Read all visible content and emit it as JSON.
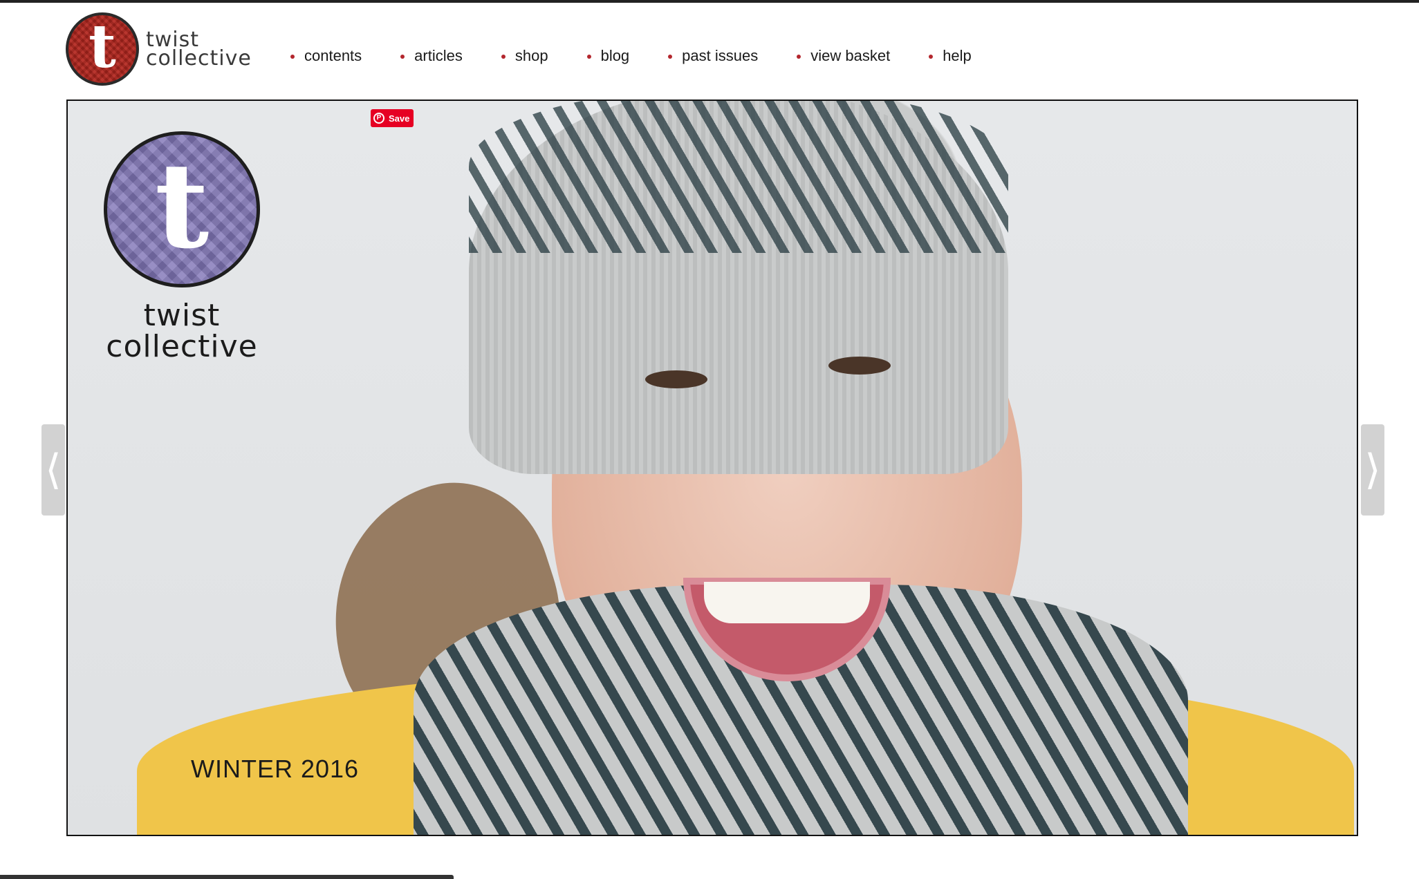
{
  "site": {
    "logo_line1": "twist",
    "logo_line2": "collective",
    "logo_letter": "t",
    "brand_red": "#b3261e"
  },
  "nav": {
    "items": [
      {
        "label": "contents"
      },
      {
        "label": "articles"
      },
      {
        "label": "shop"
      },
      {
        "label": "blog"
      },
      {
        "label": "past issues"
      },
      {
        "label": "view basket"
      },
      {
        "label": "help"
      }
    ],
    "bullet_color": "#b3262d"
  },
  "hero": {
    "pin_button": "Save",
    "issue_logo_letter": "t",
    "issue_logo_line1": "twist",
    "issue_logo_line2": "collective",
    "issue_badge_color": "#8277b8",
    "season": "WINTER 2016",
    "prev_arrow": "⟨",
    "next_arrow": "⟩"
  }
}
